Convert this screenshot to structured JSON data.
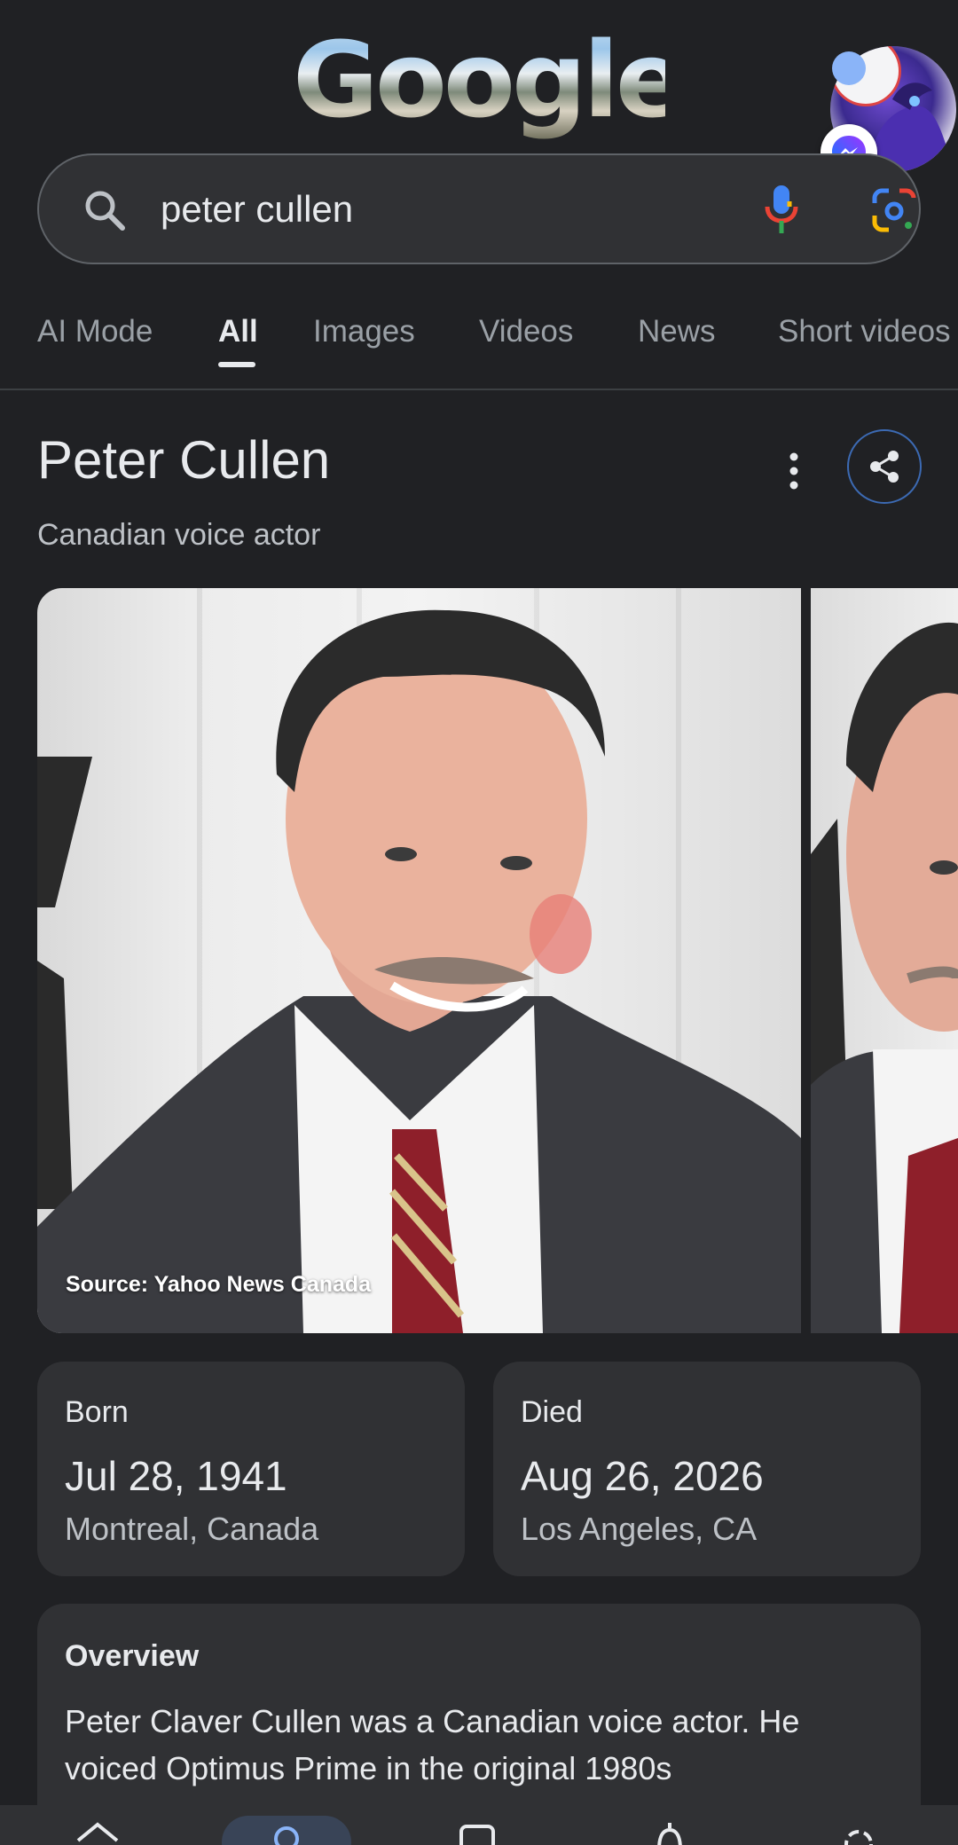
{
  "header": {
    "logo_text": "Google"
  },
  "search": {
    "query": "peter cullen"
  },
  "tabs": [
    {
      "label": "AI Mode",
      "active": false
    },
    {
      "label": "All",
      "active": true
    },
    {
      "label": "Images",
      "active": false
    },
    {
      "label": "Videos",
      "active": false
    },
    {
      "label": "News",
      "active": false
    },
    {
      "label": "Short videos",
      "active": false
    }
  ],
  "knowledge_panel": {
    "title": "Peter Cullen",
    "subtitle": "Canadian voice actor",
    "image_caption": "Source: Yahoo News Canada",
    "born": {
      "label": "Born",
      "date": "Jul 28, 1941",
      "place": "Montreal, Canada"
    },
    "died": {
      "label": "Died",
      "date": "Aug 26, 2026",
      "place": "Los Angeles, CA"
    },
    "overview": {
      "title": "Overview",
      "text": "Peter Claver Cullen was a Canadian voice actor. He voiced Optimus Prime in the original 1980s"
    }
  },
  "bottom_nav": {
    "icons": [
      "home-icon",
      "search-icon",
      "saved-icon",
      "notifications-icon",
      "more-icon"
    ]
  },
  "colors": {
    "background": "#202124",
    "surface": "#303134",
    "text_primary": "#e8eaed",
    "text_secondary": "#bdc1c6",
    "accent_blue": "#8ab4f8"
  }
}
